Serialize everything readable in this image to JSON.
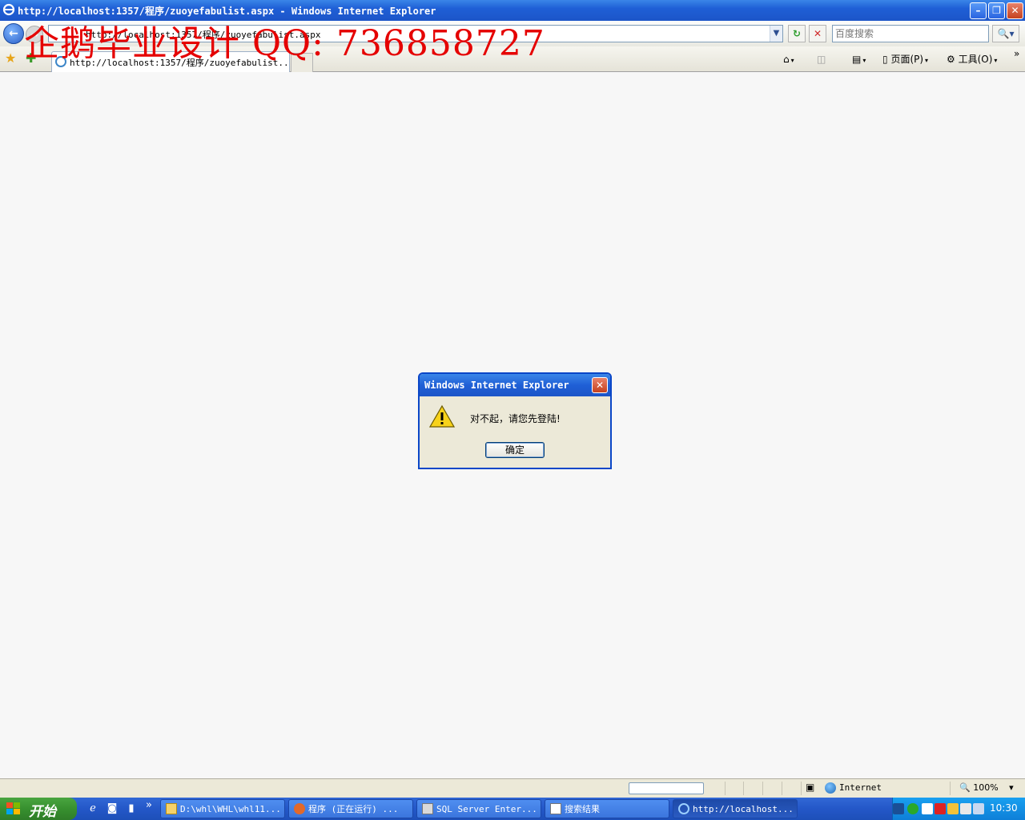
{
  "window": {
    "title": "http://localhost:1357/程序/zuoyefabulist.aspx - Windows Internet Explorer",
    "min_label": "–",
    "restore_label": "❐",
    "close_label": "✕"
  },
  "watermark": "企鹅毕业设计 QQ: 736858727",
  "address_bar": {
    "url": "http://localhost:1357/程序/zuoyefabulist.aspx",
    "back_label": "←",
    "forward_label": "→",
    "dropdown_label": "▼",
    "refresh_label": "↻",
    "stop_label": "✕"
  },
  "search": {
    "placeholder": "百度搜索",
    "go_label": "🔍▾"
  },
  "tabs": [
    {
      "label": "http://localhost:1357/程序/zuoyefabulist...."
    }
  ],
  "command_bar": {
    "home_caret": "▾",
    "print_caret": "▾",
    "page_label": "页面(P)",
    "tools_label": "工具(O)",
    "more_label": "»"
  },
  "dialog": {
    "title": "Windows Internet Explorer",
    "close_label": "✕",
    "message": "对不起，请您先登陆!",
    "ok_label": "确定"
  },
  "status_bar": {
    "zone_label": "Internet",
    "zoom_label": "100%"
  },
  "taskbar": {
    "start_label": "开始",
    "quick_launch_more": "»",
    "tasks": [
      {
        "label": "D:\\whl\\WHL\\whl11..."
      },
      {
        "label": "程序 (正在运行) ..."
      },
      {
        "label": "SQL Server Enter..."
      },
      {
        "label": "搜索结果"
      },
      {
        "label": "http://localhost..."
      }
    ],
    "clock": "10:30"
  },
  "colors": {
    "title_bar": "#2a64e0",
    "watermark": "#e50000",
    "start_button": "#37902f",
    "taskbar": "#2457c8",
    "tray": "#0e7fd8"
  }
}
